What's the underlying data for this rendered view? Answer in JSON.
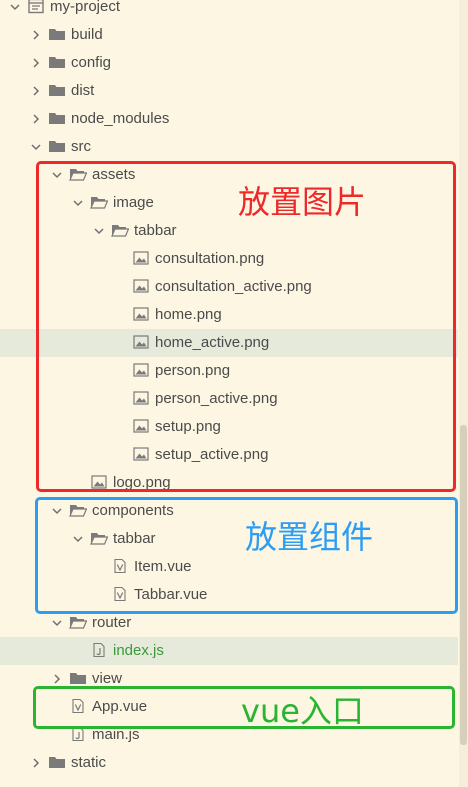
{
  "tree": [
    {
      "label": "my-project",
      "type": "project",
      "expanded": true,
      "depth": 0
    },
    {
      "label": "build",
      "type": "folder",
      "expanded": false,
      "depth": 1
    },
    {
      "label": "config",
      "type": "folder",
      "expanded": false,
      "depth": 1
    },
    {
      "label": "dist",
      "type": "folder",
      "expanded": false,
      "depth": 1
    },
    {
      "label": "node_modules",
      "type": "folder",
      "expanded": false,
      "depth": 1
    },
    {
      "label": "src",
      "type": "folder",
      "expanded": true,
      "depth": 1
    },
    {
      "label": "assets",
      "type": "folder-open",
      "expanded": true,
      "depth": 2
    },
    {
      "label": "image",
      "type": "folder-open",
      "expanded": true,
      "depth": 3
    },
    {
      "label": "tabbar",
      "type": "folder-open",
      "expanded": true,
      "depth": 4
    },
    {
      "label": "consultation.png",
      "type": "image",
      "depth": 5
    },
    {
      "label": "consultation_active.png",
      "type": "image",
      "depth": 5
    },
    {
      "label": "home.png",
      "type": "image",
      "depth": 5
    },
    {
      "label": "home_active.png",
      "type": "image",
      "depth": 5,
      "selected": true
    },
    {
      "label": "person.png",
      "type": "image",
      "depth": 5
    },
    {
      "label": "person_active.png",
      "type": "image",
      "depth": 5
    },
    {
      "label": "setup.png",
      "type": "image",
      "depth": 5
    },
    {
      "label": "setup_active.png",
      "type": "image",
      "depth": 5
    },
    {
      "label": "logo.png",
      "type": "image",
      "depth": 3
    },
    {
      "label": "components",
      "type": "folder-open",
      "expanded": true,
      "depth": 2
    },
    {
      "label": "tabbar",
      "type": "folder-open",
      "expanded": true,
      "depth": 3
    },
    {
      "label": "Item.vue",
      "type": "vue",
      "depth": 4
    },
    {
      "label": "Tabbar.vue",
      "type": "vue",
      "depth": 4
    },
    {
      "label": "router",
      "type": "folder-open",
      "expanded": true,
      "depth": 2
    },
    {
      "label": "index.js",
      "type": "js",
      "depth": 3,
      "selected": true,
      "text_color": "#3a9a3a"
    },
    {
      "label": "view",
      "type": "folder",
      "expanded": false,
      "depth": 2
    },
    {
      "label": "App.vue",
      "type": "vue",
      "depth": 2
    },
    {
      "label": "main.js",
      "type": "js",
      "depth": 2
    },
    {
      "label": "static",
      "type": "folder",
      "expanded": false,
      "depth": 1
    }
  ],
  "annotations": {
    "images": "放置图片",
    "components": "放置组件",
    "entry": "vue入口"
  },
  "colors": {
    "background": "#fdf6e3",
    "selected_row": "#e5eadb",
    "red": "#ee2929",
    "blue": "#2a9df4",
    "green": "#29b532",
    "folder": "#777777"
  }
}
